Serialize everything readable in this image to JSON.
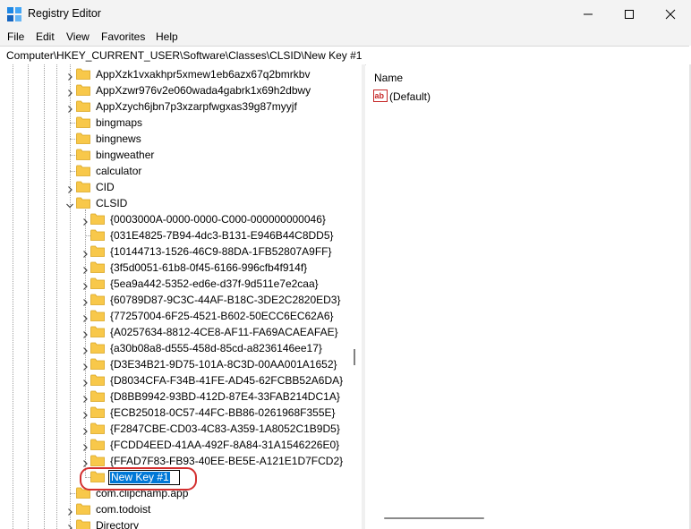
{
  "window": {
    "title": "Registry Editor",
    "controls": [
      "minimize",
      "maximize",
      "close"
    ]
  },
  "menu": [
    "File",
    "Edit",
    "View",
    "Favorites",
    "Help"
  ],
  "address": "Computer\\HKEY_CURRENT_USER\\Software\\Classes\\CLSID\\New Key #1",
  "tree": {
    "level1": [
      {
        "label": "AppXzk1vxakhpr5xmew1eb6azx67q2bmrkbv",
        "chevron": "right"
      },
      {
        "label": "AppXzwr976v2e060wada4gabrk1x69h2dbwy",
        "chevron": "right"
      },
      {
        "label": "AppXzych6jbn7p3xzarpfwgxas39g87myyjf",
        "chevron": "right"
      },
      {
        "label": "bingmaps",
        "chevron": "none"
      },
      {
        "label": "bingnews",
        "chevron": "none"
      },
      {
        "label": "bingweather",
        "chevron": "none"
      },
      {
        "label": "calculator",
        "chevron": "none"
      },
      {
        "label": "CID",
        "chevron": "right"
      },
      {
        "label": "CLSID",
        "chevron": "down"
      }
    ],
    "clsid_children": [
      {
        "label": "{0003000A-0000-0000-C000-000000000046}",
        "chevron": "right"
      },
      {
        "label": "{031E4825-7B94-4dc3-B131-E946B44C8DD5}",
        "chevron": "none"
      },
      {
        "label": "{10144713-1526-46C9-88DA-1FB52807A9FF}",
        "chevron": "right"
      },
      {
        "label": "{3f5d0051-61b8-0f45-6166-996cfb4f914f}",
        "chevron": "right"
      },
      {
        "label": "{5ea9a442-5352-ed6e-d37f-9d511e7e2caa}",
        "chevron": "right"
      },
      {
        "label": "{60789D87-9C3C-44AF-B18C-3DE2C2820ED3}",
        "chevron": "right"
      },
      {
        "label": "{77257004-6F25-4521-B602-50ECC6EC62A6}",
        "chevron": "right"
      },
      {
        "label": "{A0257634-8812-4CE8-AF11-FA69ACAEAFAE}",
        "chevron": "right"
      },
      {
        "label": "{a30b08a8-d555-458d-85cd-a8236146ee17}",
        "chevron": "right"
      },
      {
        "label": "{D3E34B21-9D75-101A-8C3D-00AA001A1652}",
        "chevron": "right"
      },
      {
        "label": "{D8034CFA-F34B-41FE-AD45-62FCBB52A6DA}",
        "chevron": "right"
      },
      {
        "label": "{D8BB9942-93BD-412D-87E4-33FAB214DC1A}",
        "chevron": "right"
      },
      {
        "label": "{ECB25018-0C57-44FC-BB86-0261968F355E}",
        "chevron": "right"
      },
      {
        "label": "{F2847CBE-CD03-4C83-A359-1A8052C1B9D5}",
        "chevron": "right"
      },
      {
        "label": "{FCDD4EED-41AA-492F-8A84-31A1546226E0}",
        "chevron": "right"
      },
      {
        "label": "{FFAD7F83-FB93-40EE-BE5E-A121E1D7FCD2}",
        "chevron": "right"
      }
    ],
    "new_key": {
      "label": "New Key #1",
      "editing": true
    },
    "after": [
      {
        "label": "com.clipchamp.app",
        "chevron": "none"
      },
      {
        "label": "com.todoist",
        "chevron": "right"
      },
      {
        "label": "Directory",
        "chevron": "right"
      }
    ]
  },
  "values_pane": {
    "column_header": "Name",
    "items": [
      {
        "name": "(Default)",
        "icon": "string-value-icon"
      }
    ]
  },
  "colors": {
    "folder": "#f8c84a",
    "selection": "#0078d7",
    "highlight": "#d32f2f"
  }
}
